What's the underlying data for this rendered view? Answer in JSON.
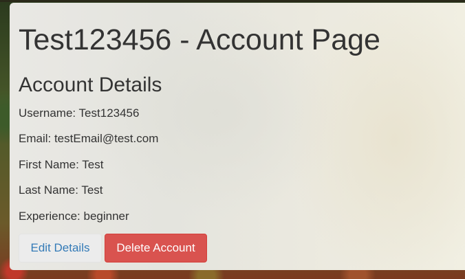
{
  "page": {
    "title": "Test123456 - Account Page",
    "section_title": "Account Details"
  },
  "details": {
    "username": "Username: Test123456",
    "email": "Email: testEmail@test.com",
    "first_name": "First Name: Test",
    "last_name": "Last Name: Test",
    "experience": "Experience: beginner"
  },
  "actions": {
    "edit_label": "Edit Details",
    "delete_label": "Delete Account"
  },
  "colors": {
    "text": "#333333",
    "link_blue": "#337ab7",
    "danger": "#d9534f"
  }
}
